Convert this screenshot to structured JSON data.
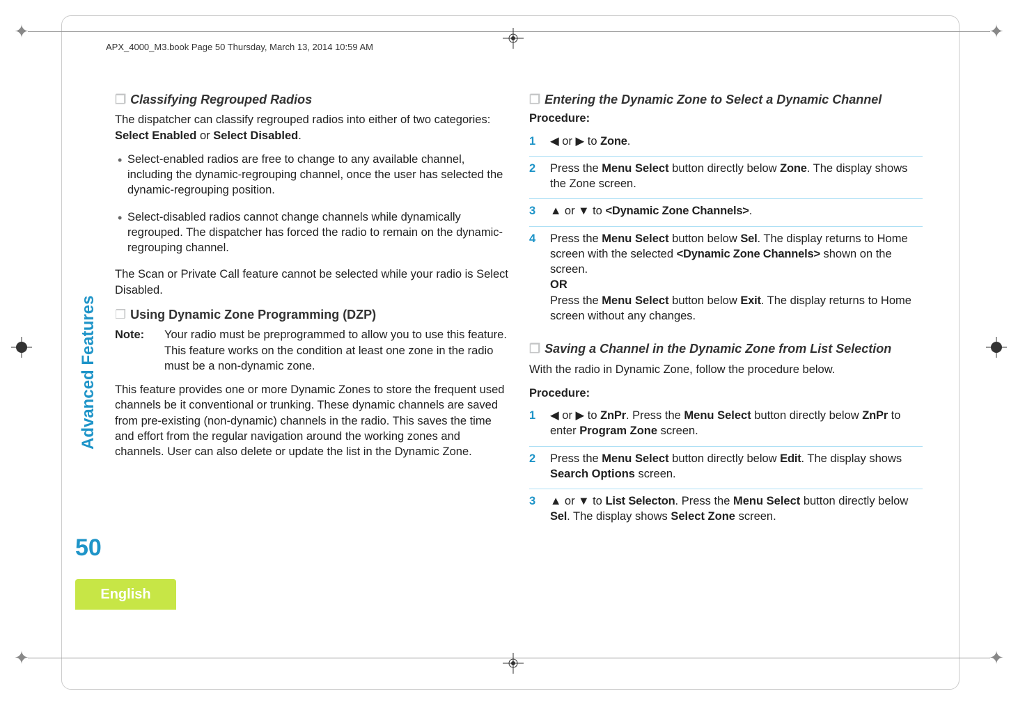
{
  "header": "APX_4000_M3.book  Page 50  Thursday, March 13, 2014  10:59 AM",
  "side_tab": "Advanced Features",
  "page_number": "50",
  "language": "English",
  "left": {
    "sec1_title": "Classifying Regrouped Radios",
    "sec1_p1a": "The dispatcher can classify regrouped radios into either of two categories: ",
    "sec1_p1b": "Select Enabled",
    "sec1_p1c": " or ",
    "sec1_p1d": "Select Disabled",
    "sec1_p1e": ".",
    "sec1_b1": "Select-enabled radios are free to change to any available channel, including the dynamic-regrouping channel, once the user has selected the dynamic-regrouping position.",
    "sec1_b2": "Select-disabled radios cannot change channels while dynamically regrouped. The dispatcher has forced the radio to remain on the dynamic-regrouping channel.",
    "sec1_p2": "The Scan or Private Call feature cannot be selected while your radio is Select Disabled.",
    "sec2_title": "Using Dynamic Zone Programming (DZP)",
    "note_label": "Note:",
    "note_body": "Your radio must be preprogrammed to allow you to use this feature.\nThis feature works on the condition at least one zone in the radio must be a non-dynamic zone.",
    "sec2_p1": "This feature provides one or more Dynamic Zones to store the frequent used channels be it conventional or trunking. These dynamic channels are saved from pre-existing (non-dynamic) channels in the radio. This saves the time and effort from the regular navigation around the working zones and channels. User can also delete or update the list in the Dynamic Zone."
  },
  "right": {
    "sec3_title": "Entering the Dynamic Zone to Select a Dynamic Channel",
    "procedure": "Procedure:",
    "s3_1a": "◀ or ▶ to ",
    "s3_1b": "Zone",
    "s3_1c": ".",
    "s3_2a": "Press the ",
    "s3_2b": "Menu Select",
    "s3_2c": " button directly below ",
    "s3_2d": "Zone",
    "s3_2e": ". The display shows the Zone screen.",
    "s3_3a": "▲ or ▼ to ",
    "s3_3b": "<Dynamic Zone Channels>",
    "s3_3c": ".",
    "s3_4a": "Press the ",
    "s3_4b": "Menu Select",
    "s3_4c": " button below ",
    "s3_4d": "Sel",
    "s3_4e": ". The display returns to Home screen with the selected ",
    "s3_4f": "<Dynamic Zone Channels>",
    "s3_4g": " shown on the screen.",
    "s3_4_or": "OR",
    "s3_4h": "Press the ",
    "s3_4i": "Menu Select",
    "s3_4j": " button below ",
    "s3_4k": "Exit",
    "s3_4l": ". The display returns to Home screen without any changes.",
    "sec4_title": "Saving a Channel in the Dynamic Zone from List Selection",
    "sec4_p1": "With the radio in Dynamic Zone, follow the procedure below.",
    "s4_1a": "◀ or ▶ to ",
    "s4_1b": "ZnPr",
    "s4_1c": ". Press the ",
    "s4_1d": "Menu Select",
    "s4_1e": " button directly below ",
    "s4_1f": "ZnPr",
    "s4_1g": " to enter ",
    "s4_1h": "Program Zone",
    "s4_1i": " screen.",
    "s4_2a": "Press the ",
    "s4_2b": "Menu Select",
    "s4_2c": " button directly below ",
    "s4_2d": "Edit",
    "s4_2e": ". The display shows ",
    "s4_2f": "Search Options",
    "s4_2g": " screen.",
    "s4_3a": "▲ or ▼ to ",
    "s4_3b": "List Selecton",
    "s4_3c": ". Press the ",
    "s4_3d": "Menu Select",
    "s4_3e": " button directly below ",
    "s4_3f": "Sel",
    "s4_3g": ". The display shows ",
    "s4_3h": "Select Zone",
    "s4_3i": " screen."
  }
}
